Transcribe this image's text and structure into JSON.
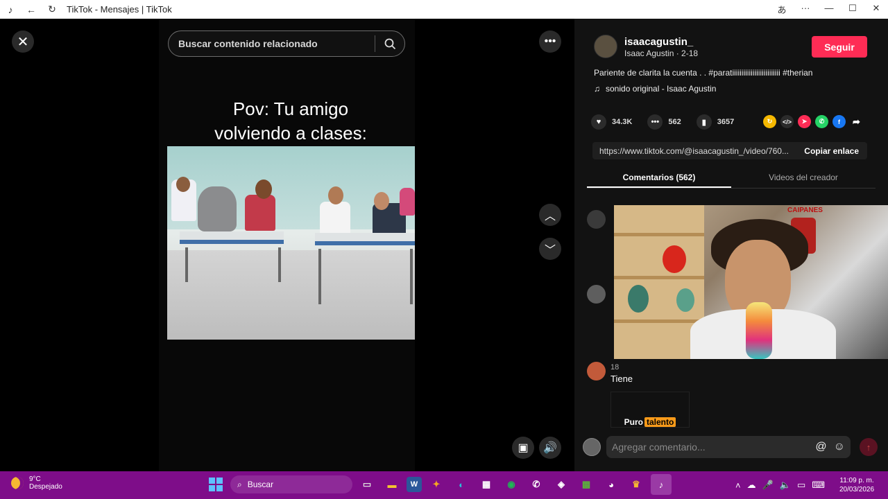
{
  "window": {
    "title": "TikTok - Mensajes | TikTok",
    "app_icon": "tiktok-icon",
    "controls": [
      "translate-icon",
      "more-icon",
      "minimize-icon",
      "maximize-icon",
      "close-icon"
    ]
  },
  "stage": {
    "search_placeholder": "Buscar contenido relacionado",
    "caption_line1": "Pov: Tu amigo",
    "caption_line2": "volviendo a clases:"
  },
  "panel": {
    "author": {
      "username": "isaacagustin_",
      "display_line": "Isaac Agustin · 2-18",
      "follow_label": "Seguir"
    },
    "description": "Pariente de clarita la cuenta . . #paratiiiiiiiiiiiiiiiiiiiiiiiiii #therian",
    "sound": "sonido original - Isaac Agustin",
    "stats": {
      "likes": "34.3K",
      "comments": "562",
      "saves": "3657"
    },
    "link": {
      "url": "https://www.tiktok.com/@isaacagustin_/video/760...",
      "copy_label": "Copiar enlace"
    },
    "tabs": [
      "Comentarios (562)",
      "Videos del creador"
    ],
    "comment_item": {
      "meta": "18",
      "text": "Tiene",
      "sticker_word1": "Puro",
      "sticker_word2": "talento"
    },
    "webcam_label": "CAIPANES",
    "comment_placeholder": "Agregar comentario..."
  },
  "taskbar": {
    "temperature": "9°C",
    "weather": "Despejado",
    "search_label": "Buscar",
    "time": "11:09 p. m.",
    "date": "20/03/2026",
    "accent": "#7e0d89"
  },
  "colors": {
    "follow": "#fe2c55",
    "panel_bg": "#121212"
  }
}
